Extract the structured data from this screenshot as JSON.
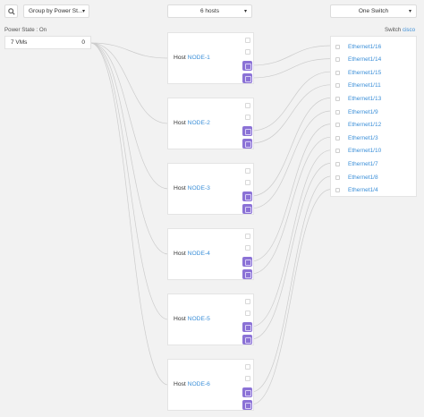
{
  "toolbar": {
    "search_icon": "search-icon",
    "group_by_label": "Group by Power St...",
    "hosts_label": "6 hosts",
    "switch_label": "One Switch",
    "chevron": "▾"
  },
  "vms": {
    "section_label": "Power State : On",
    "card_label": "7 VMs",
    "card_count": "0"
  },
  "hosts": [
    {
      "prefix": "Host",
      "name": "NODE-1"
    },
    {
      "prefix": "Host",
      "name": "NODE-2"
    },
    {
      "prefix": "Host",
      "name": "NODE-3"
    },
    {
      "prefix": "Host",
      "name": "NODE-4"
    },
    {
      "prefix": "Host",
      "name": "NODE-5"
    },
    {
      "prefix": "Host",
      "name": "NODE-6"
    }
  ],
  "switch": {
    "prefix": "Switch",
    "brand": "cisco",
    "ports": [
      "Ethernet1/16",
      "Ethernet1/14",
      "Ethernet1/15",
      "Ethernet1/11",
      "Ethernet1/13",
      "Ethernet1/9",
      "Ethernet1/12",
      "Ethernet1/3",
      "Ethernet1/10",
      "Ethernet1/7",
      "Ethernet1/8",
      "Ethernet1/4"
    ]
  },
  "colors": {
    "accent": "#3b8fd8",
    "nic": "#8b72d6",
    "background": "#f2f2f2"
  }
}
